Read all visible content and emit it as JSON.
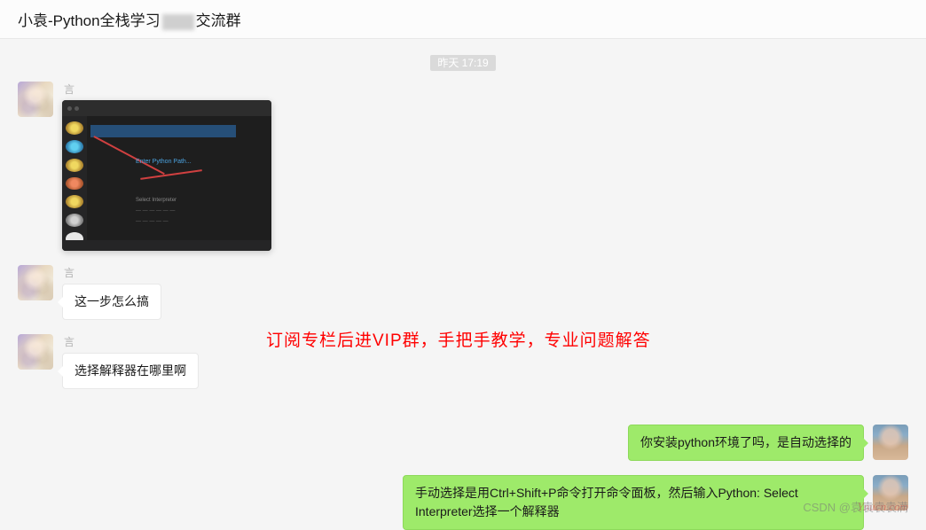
{
  "header": {
    "title_prefix": "小袁-Python全栈学习",
    "title_suffix": "交流群"
  },
  "timestamp": "昨天 17:19",
  "messages": [
    {
      "side": "left",
      "sender": "言",
      "type": "image",
      "avatar": "anime"
    },
    {
      "side": "left",
      "sender": "言",
      "type": "text",
      "avatar": "anime",
      "text": "这一步怎么搞"
    },
    {
      "side": "left",
      "sender": "言",
      "type": "text",
      "avatar": "anime",
      "text": "选择解释器在哪里啊"
    },
    {
      "side": "right",
      "sender": "",
      "type": "text",
      "avatar": "person",
      "text": "你安装python环境了吗，是自动选择的"
    },
    {
      "side": "right",
      "sender": "",
      "type": "text",
      "avatar": "person",
      "text": "手动选择是用Ctrl+Shift+P命令打开命令面板，然后输入Python: Select Interpreter选择一个解释器"
    }
  ],
  "overlay": "订阅专栏后进VIP群，手把手教学，专业问题解答",
  "screenshot": {
    "link_text": "Enter Python Path...",
    "hint_text": "Select Interpreter"
  },
  "watermark": {
    "top": "Ynucn.com",
    "bottom": "CSDN @袁袁袁袁满"
  }
}
